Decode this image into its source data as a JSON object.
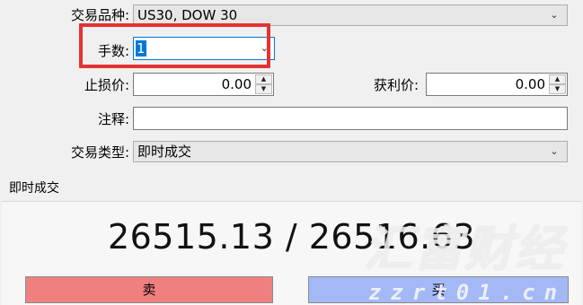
{
  "form": {
    "symbol_label": "交易品种:",
    "symbol_value": "US30, DOW 30",
    "lots_label": "手数:",
    "lots_value": "1",
    "stop_loss_label": "止损价:",
    "stop_loss_value": "0.00",
    "take_profit_label": "获利价:",
    "take_profit_value": "0.00",
    "comment_label": "注释:",
    "comment_value": "",
    "order_type_label": "交易类型:",
    "order_type_value": "即时成交"
  },
  "execution": {
    "section_title": "即时成交",
    "price_text": "26515.13 / 26516.63",
    "sell_label": "卖",
    "buy_label": "买"
  },
  "watermark": {
    "text": "汇富财经",
    "url": "zzrt01.cn"
  },
  "colors": {
    "highlight": "#e53232",
    "sell_button": "#f08080",
    "buy_button": "#a4b8f5",
    "selection": "#0078d7"
  }
}
